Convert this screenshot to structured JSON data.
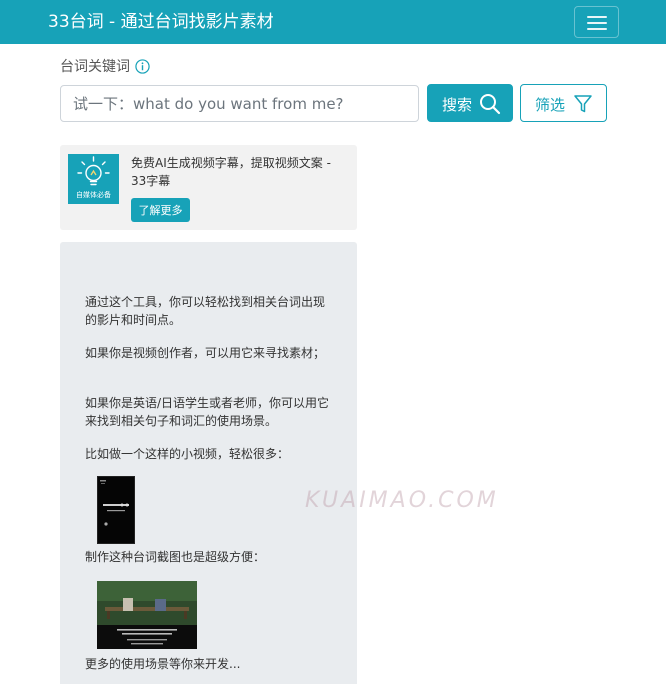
{
  "navbar": {
    "brand": "33台词 - 通过台词找影片素材",
    "toggle_icon": "hamburger-menu-icon",
    "color": "#17a2b8"
  },
  "search": {
    "label": "台词关键词",
    "info_icon": "info-icon",
    "placeholder": "试一下：what do you want from me?",
    "value": "",
    "search_button": "搜索",
    "filter_button": "筛选"
  },
  "ad": {
    "logo_text": "自媒体必备",
    "text": "免费AI生成视频字幕，提取视频文案 - 33字幕",
    "button": "了解更多"
  },
  "intro": {
    "p1": "通过这个工具，你可以轻松找到相关台词出现的影片和时间点。",
    "p2": "如果你是视频创作者，可以用它来寻找素材；",
    "p3": "如果你是英语/日语学生或者老师，你可以用它来找到相关句子和词汇的使用场景。",
    "p4": "比如做一个这样的小视频，轻松很多：",
    "p5": "制作这种台词截图也是超级方便：",
    "p6": "更多的使用场景等你来开发..."
  },
  "watermark": "KUAIMAO.COM"
}
